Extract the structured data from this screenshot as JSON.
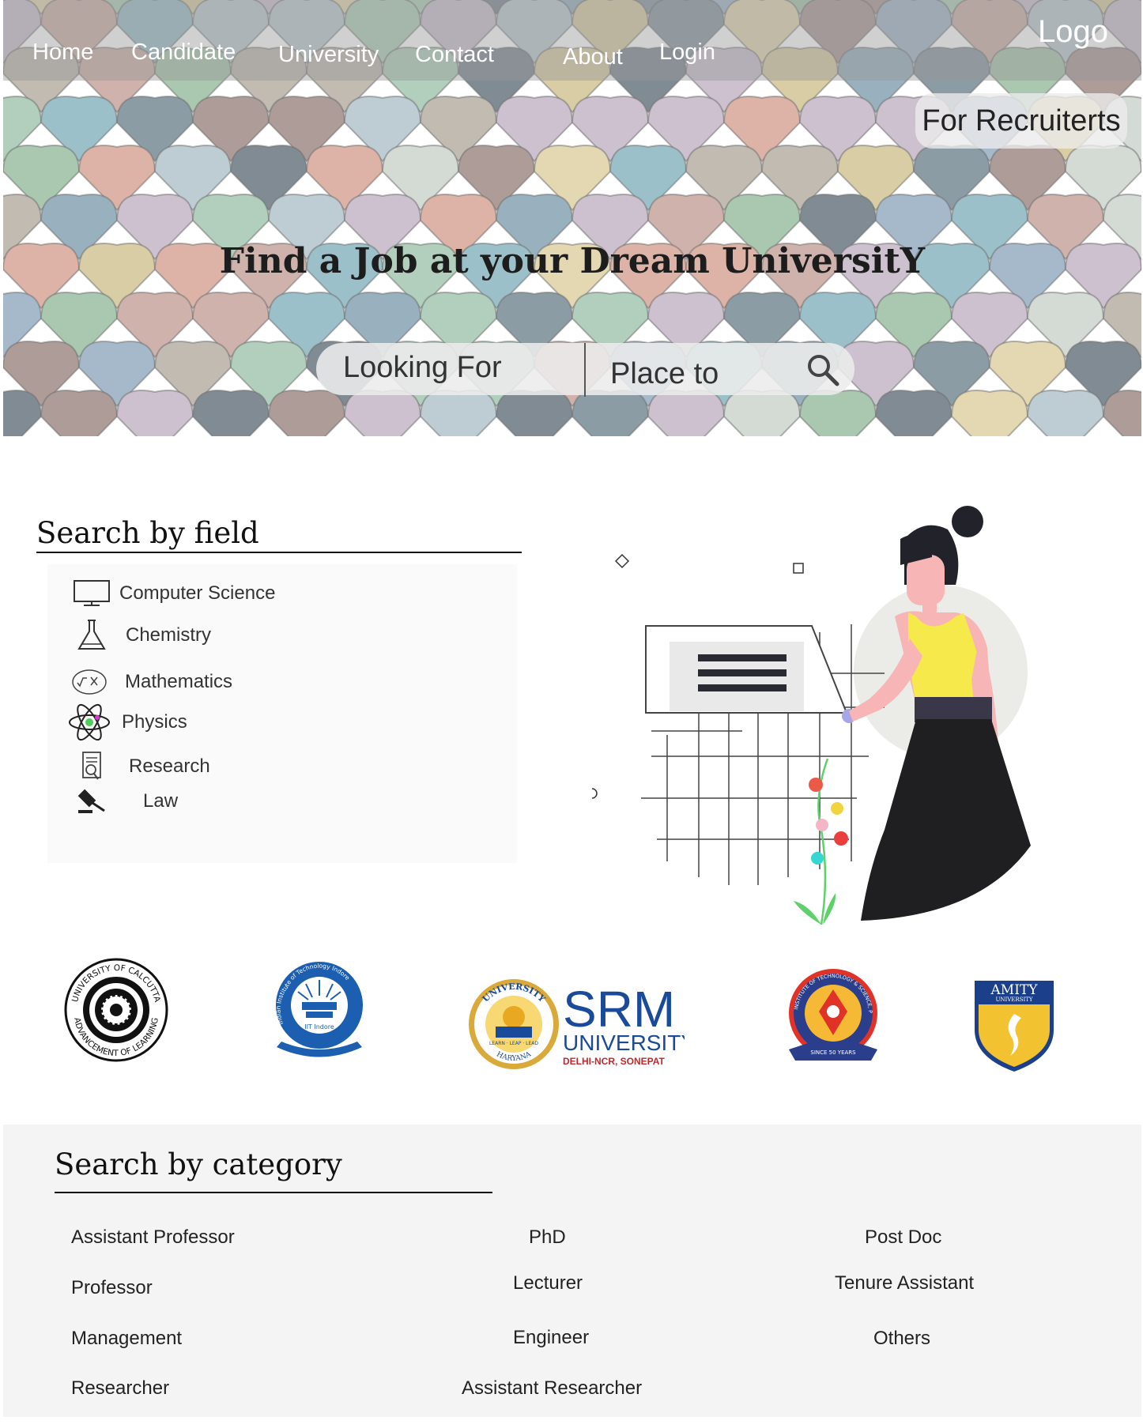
{
  "nav": {
    "items": [
      "Home",
      "Candidate",
      "University",
      "Contact",
      "About",
      "Login"
    ],
    "logo": "Logo"
  },
  "hero": {
    "recruiter_button": "For Recruiterts",
    "title": "Find a Job at your Dream UniversitY",
    "search": {
      "looking_for": "Looking For",
      "place_to": "Place to"
    }
  },
  "fields": {
    "title": "Search by field",
    "items": [
      {
        "label": "Computer Science",
        "icon": "monitor-icon"
      },
      {
        "label": "Chemistry",
        "icon": "flask-icon"
      },
      {
        "label": "Mathematics",
        "icon": "math-icon"
      },
      {
        "label": "Physics",
        "icon": "atom-icon"
      },
      {
        "label": "Research",
        "icon": "document-search-icon"
      },
      {
        "label": "Law",
        "icon": "gavel-icon"
      }
    ]
  },
  "universities": {
    "calcutta": {
      "top": "UNIVERSITY OF CALCUTTA",
      "bottom": "ADVANCEMENT OF LEARNING"
    },
    "iit_indore": {
      "ring": "Indian Institute of Technology Indore",
      "center": "IIT Indore"
    },
    "srm": {
      "big": "SRM",
      "sub": "UNIVERSITY",
      "place": "DELHI-NCR, SONEPAT",
      "seal_top": "UNIVERSITY",
      "seal_bottom": "HARYANA",
      "seal_motto": "LEARN · LEAP · LEAD"
    },
    "bit": {
      "ring": "BIRLA INSTITUTE OF TECHNOLOGY & SCIENCE, PILANI",
      "banner": "SINCE 50 YEARS"
    },
    "amity": {
      "name": "AMITY",
      "sub": "UNIVERSITY"
    }
  },
  "categories": {
    "title": "Search by category",
    "items": [
      "Assistant Professor",
      "PhD",
      "Post Doc",
      "Professor",
      "Lecturer",
      "Tenure Assistant",
      "Management",
      "Engineer",
      "Others",
      "Researcher",
      "Assistant Researcher"
    ]
  },
  "colors": {
    "nav_text": "#ffffff",
    "body_text": "#222222",
    "category_bg": "#f3f4f3",
    "srm_blue": "#1a4a9a",
    "srm_red": "#c1272d",
    "amity_blue": "#1b3f8b",
    "amity_gold": "#f2c230"
  }
}
